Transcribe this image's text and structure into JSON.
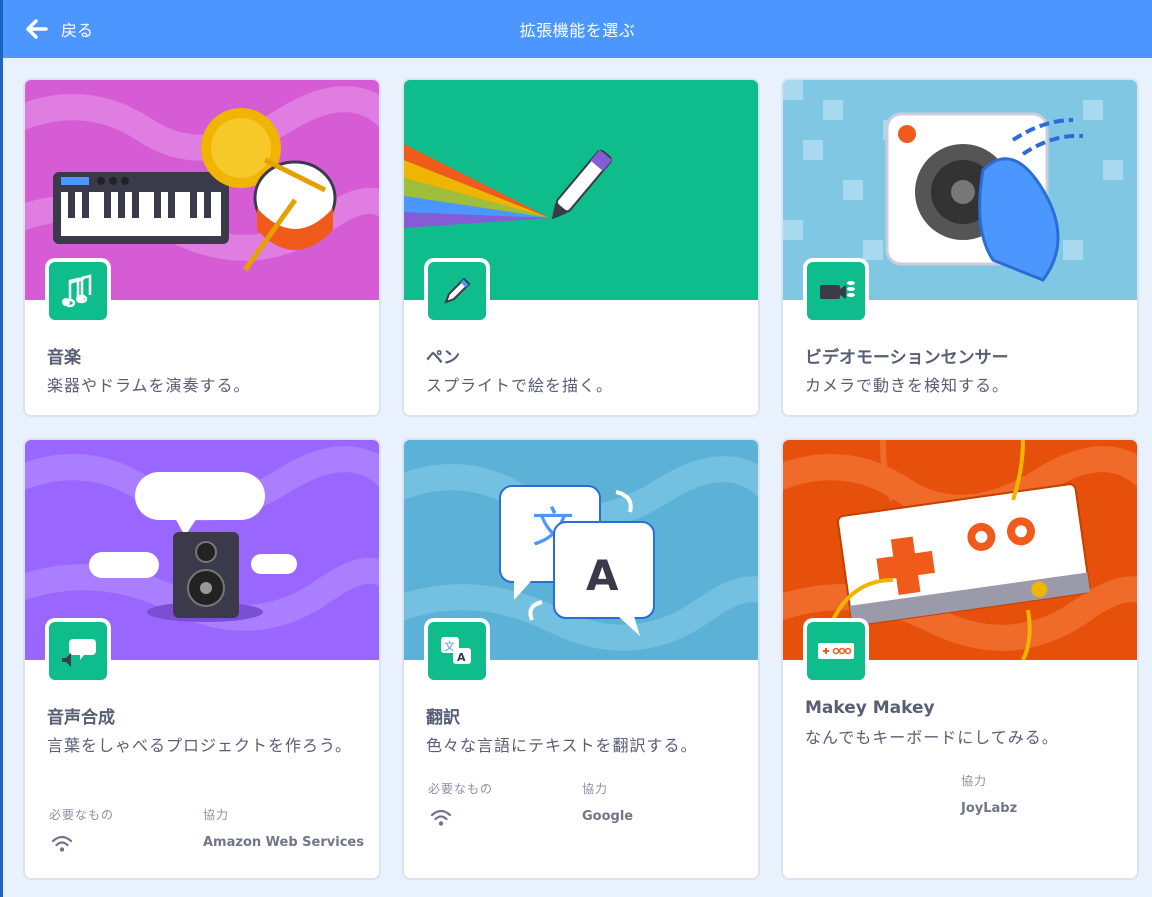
{
  "header": {
    "back_label": "戻る",
    "title": "拡張機能を選ぶ"
  },
  "colors": {
    "header": "#4c97ff",
    "icon_bg": "#0fbd8c",
    "text": "#575e75"
  },
  "extensions": [
    {
      "name": "音楽",
      "description": "楽器やドラムを演奏する。",
      "icon": "music-notes-icon"
    },
    {
      "name": "ペン",
      "description": "スプライトで絵を描く。",
      "icon": "pen-icon"
    },
    {
      "name": "ビデオモーションセンサー",
      "description": "カメラで動きを検知する。",
      "icon": "video-camera-icon"
    },
    {
      "name": "音声合成",
      "description": "言葉をしゃべるプロジェクトを作ろう。",
      "icon": "speech-bubble-icon",
      "requires_label": "必要なもの",
      "requires_icon": "wifi-icon",
      "collab_label": "協力",
      "collab_value": "Amazon Web Services"
    },
    {
      "name": "翻訳",
      "description": "色々な言語にテキストを翻訳する。",
      "icon": "translate-icon",
      "requires_label": "必要なもの",
      "requires_icon": "wifi-icon",
      "collab_label": "協力",
      "collab_value": "Google"
    },
    {
      "name": "Makey Makey",
      "description": "なんでもキーボードにしてみる。",
      "icon": "makey-board-icon",
      "collab_label": "協力",
      "collab_value": "JoyLabz"
    }
  ]
}
